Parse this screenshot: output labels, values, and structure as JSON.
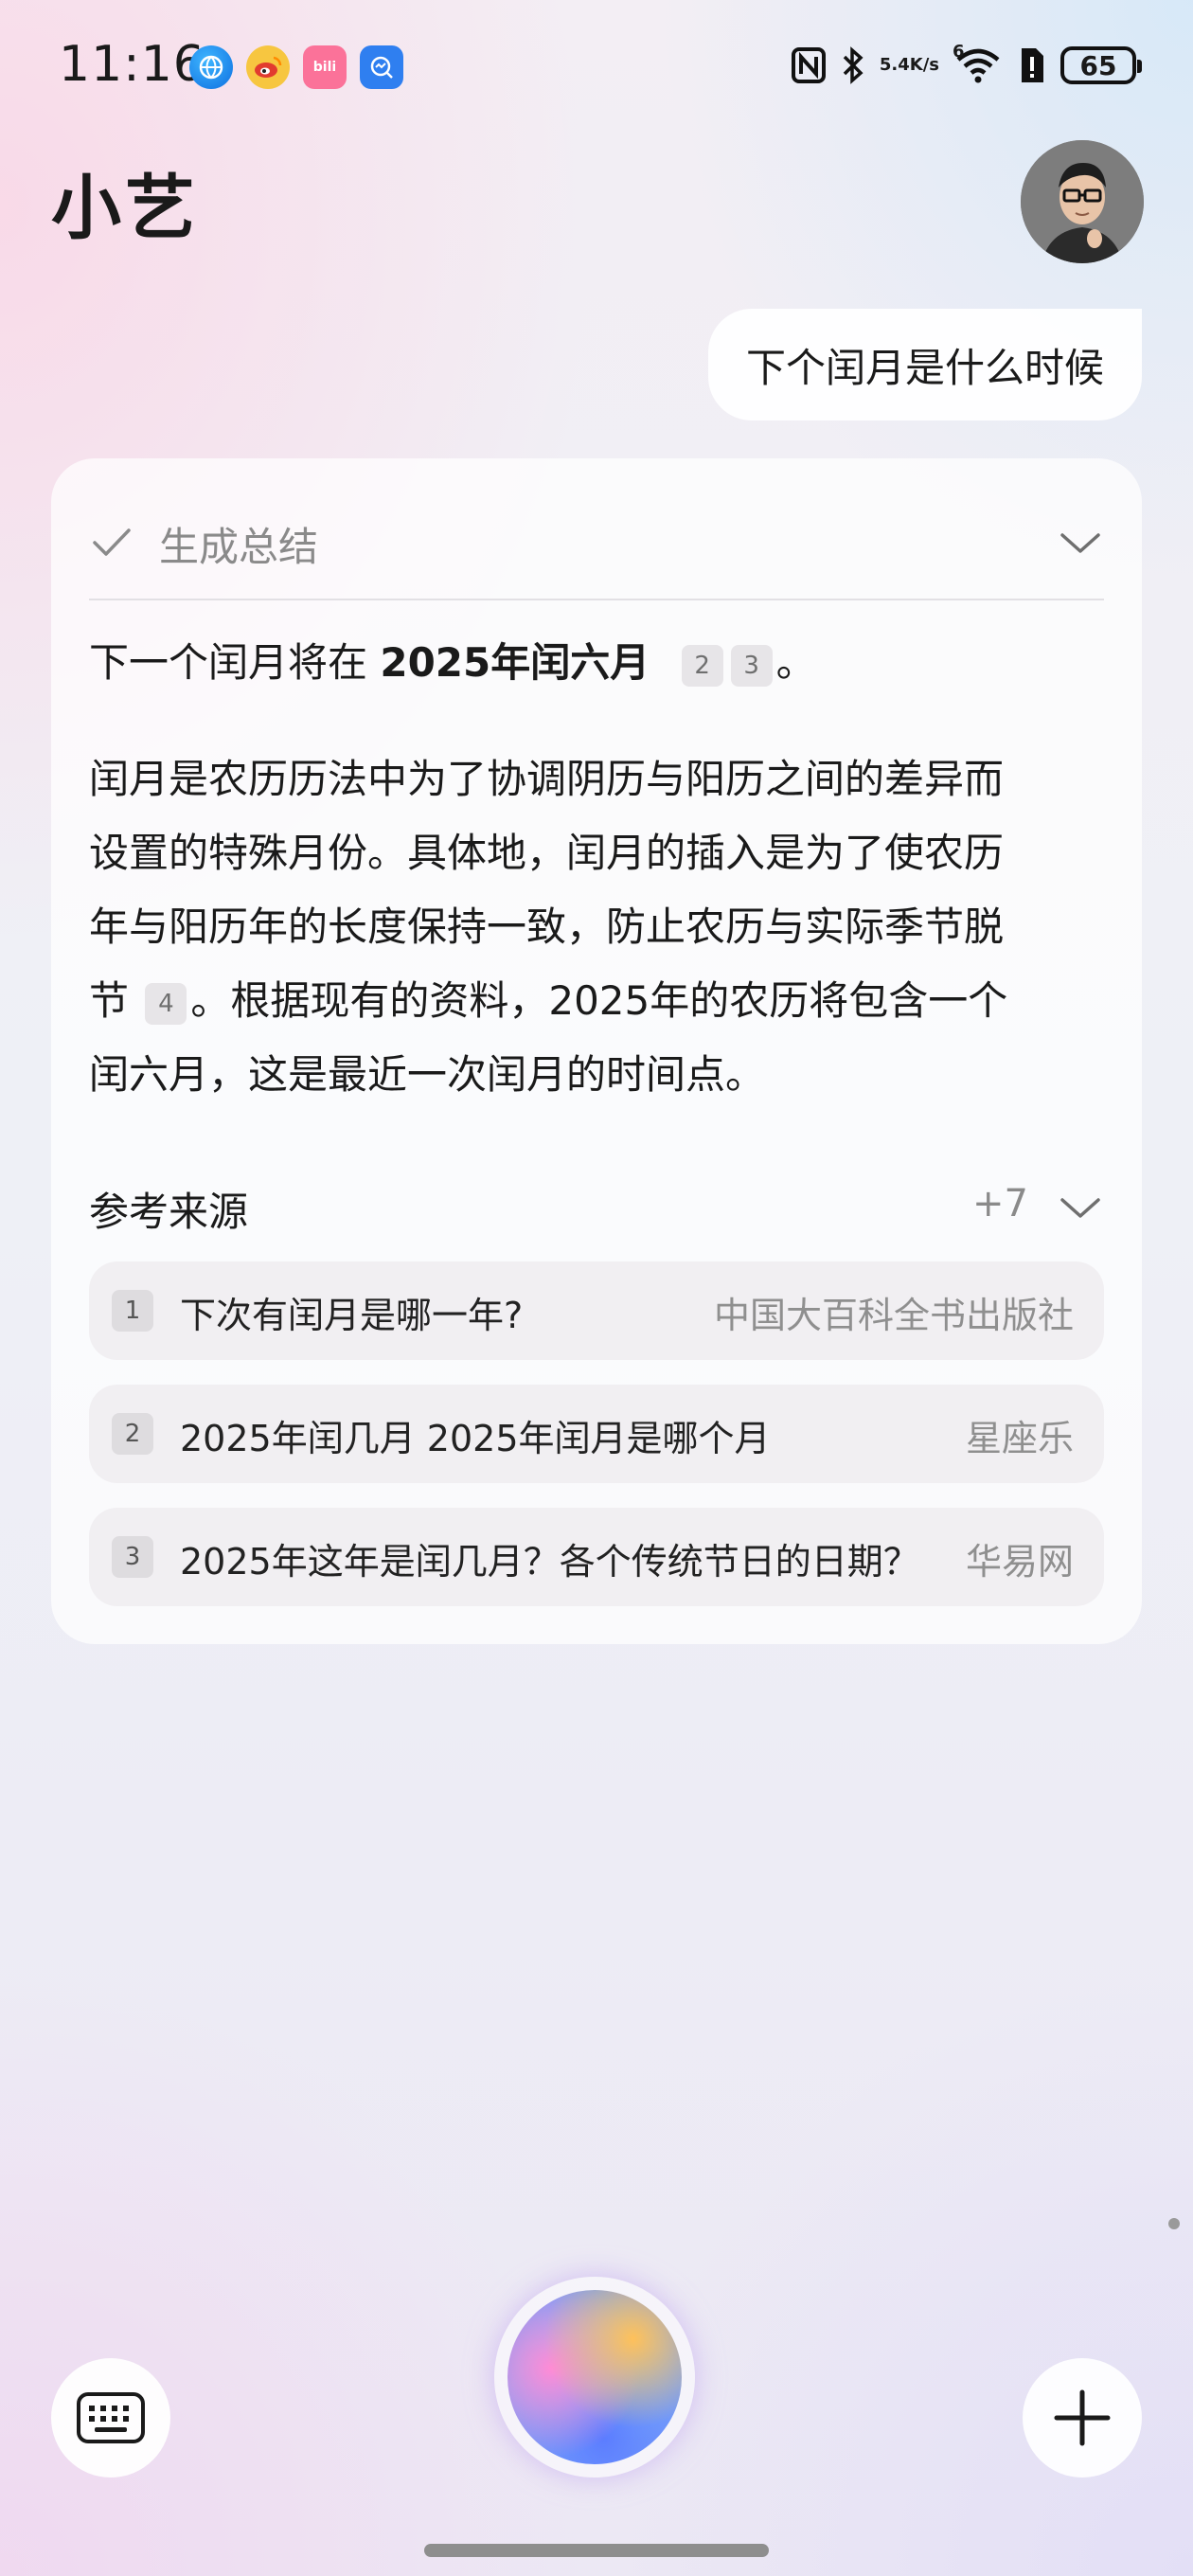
{
  "status_bar": {
    "time": "11:16",
    "network_speed_value": "5.4",
    "network_speed_unit": "K/s",
    "signal_label": "6",
    "battery": "65",
    "app_icons": [
      "browser-icon",
      "weibo-icon",
      "bilibili-icon",
      "message-icon"
    ],
    "bili_text": "bili"
  },
  "header": {
    "title": "小艺"
  },
  "conversation": {
    "user_message": "下个闰月是什么时候",
    "summary_label": "生成总结",
    "answer_lead_prefix": "下一个闰月将在 ",
    "answer_lead_bold": "2025年闰六月",
    "answer_lead_citations": [
      "2",
      "3"
    ],
    "answer_lead_suffix": "。",
    "answer_body_lines": [
      "闰月是农历历法中为了协调阴历与阳历之间的差异而",
      "设置的特殊月份。具体地，闰月的插入是为了使农历",
      "年与阳历年的长度保持一致，防止农历与实际季节脱"
    ],
    "answer_body_line4_prefix": "节 ",
    "answer_body_line4_citation": "4",
    "answer_body_line4_suffix": "。根据现有的资料，2025年的农历将包含一个",
    "answer_body_line5": "闰六月，这是最近一次闰月的时间点。",
    "references": {
      "title": "参考来源",
      "more_count": "+7",
      "items": [
        {
          "num": "1",
          "title": "下次有闰月是哪一年?",
          "source": "中国大百科全书出版社"
        },
        {
          "num": "2",
          "title": "2025年闰几月 2025年闰月是哪个月",
          "source": "星座乐"
        },
        {
          "num": "3",
          "title": "2025年这年是闰几月？各个传统节日的日期？",
          "source": "华易网"
        }
      ]
    }
  },
  "colors": {
    "accent_orb_orange": "#ffc15a",
    "accent_orb_pink": "#ff8bd6",
    "accent_orb_blue": "#5b7cff",
    "muted_text": "#8a8a8a"
  }
}
